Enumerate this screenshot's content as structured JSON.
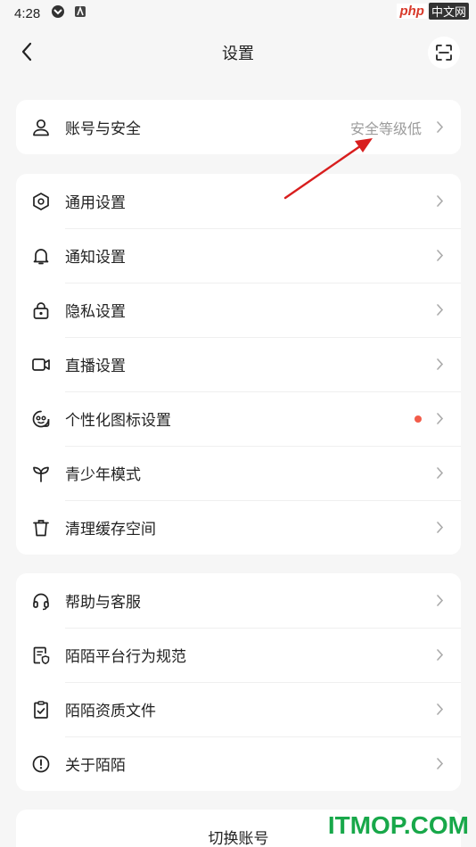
{
  "status_bar": {
    "time": "4:28"
  },
  "watermark_top": {
    "logo": "php",
    "text": "中文网"
  },
  "header": {
    "title": "设置"
  },
  "account_card": {
    "label": "账号与安全",
    "value": "安全等级低"
  },
  "general_card": {
    "items": [
      {
        "label": "通用设置",
        "icon": "hexagon-settings-icon"
      },
      {
        "label": "通知设置",
        "icon": "bell-icon"
      },
      {
        "label": "隐私设置",
        "icon": "lock-icon"
      },
      {
        "label": "直播设置",
        "icon": "video-camera-icon"
      },
      {
        "label": "个性化图标设置",
        "icon": "face-icon",
        "has_dot": true
      },
      {
        "label": "青少年模式",
        "icon": "sprout-icon"
      },
      {
        "label": "清理缓存空间",
        "icon": "trash-icon"
      }
    ]
  },
  "help_card": {
    "items": [
      {
        "label": "帮助与客服",
        "icon": "headset-icon"
      },
      {
        "label": "陌陌平台行为规范",
        "icon": "document-shield-icon"
      },
      {
        "label": "陌陌资质文件",
        "icon": "clipboard-check-icon"
      },
      {
        "label": "关于陌陌",
        "icon": "info-circle-icon"
      }
    ]
  },
  "switch_account": {
    "label": "切换账号"
  },
  "watermark_bottom": {
    "text": "ITMOP.COM"
  },
  "colors": {
    "background": "#f6f6f6",
    "card": "#ffffff",
    "text": "#222222",
    "secondary_text": "#9c9c9c",
    "dot": "#f25c4a",
    "annotation": "#d81e1e",
    "watermark_green": "#18a84a"
  }
}
